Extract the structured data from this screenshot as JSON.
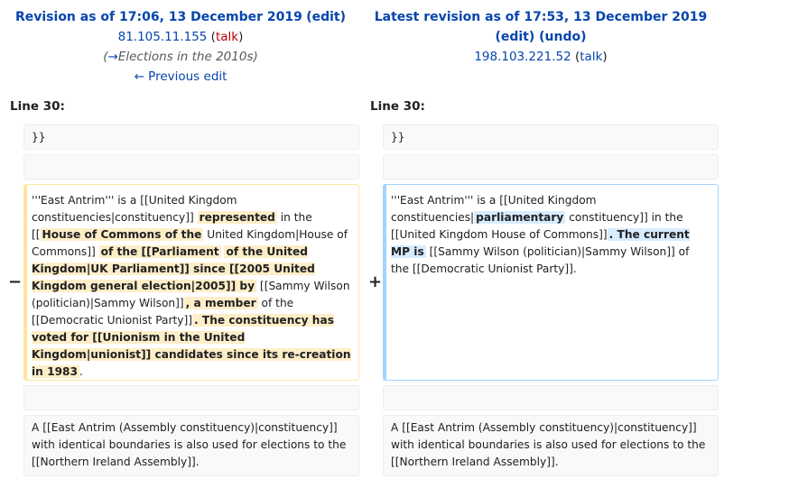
{
  "left_header": {
    "title": "Revision as of 17:06, 13 December 2019",
    "edit_label": "edit",
    "user_ip": "81.105.11.155",
    "talk_label": "talk",
    "comment_arrow": "→",
    "comment_text": "Elections in the 2010s",
    "prev_edit": "← Previous edit"
  },
  "right_header": {
    "title": "Latest revision as of 17:53, 13 December 2019",
    "edit_label": "edit",
    "undo_label": "undo",
    "user_ip": "198.103.221.52",
    "talk_label": "talk"
  },
  "line_label_left": "Line 30:",
  "line_label_right": "Line 30:",
  "rows": {
    "r1_left": "}}",
    "r1_right": "}}",
    "del_marker": "−",
    "ins_marker": "+",
    "del": {
      "p1": "'''East Antrim''' is a [[United Kingdom constituencies|constituency]] ",
      "x1": "represented",
      "p2": " in the [[",
      "x2": "House of Commons of the",
      "p3": " United Kingdom|House of Commons]] ",
      "x3": "of the [[Parliament",
      "p4": " ",
      "x4": "of the United Kingdom|UK Parliament]] since [[2005 United Kingdom general election|2005]] by",
      "p5": " [[Sammy Wilson (politician)|Sammy Wilson]]",
      "x5": ", a member",
      "p6": " of the [[Democratic Unionist Party]]",
      "x6": ". The constituency has voted for [[Unionism in the United Kingdom|unionist]] candidates since its re-creation in 1983",
      "p7": "."
    },
    "ins": {
      "p1": "'''East Antrim''' is a [[United Kingdom constituencies|",
      "x1": "parliamentary",
      "p2": " constituency]] in the [[United Kingdom House of Commons]]",
      "x2": ". The current MP is",
      "p3": " [[Sammy Wilson (politician)|Sammy Wilson]] of the [[Democratic Unionist Party]]."
    },
    "r3_left": "A [[East Antrim (Assembly constituency)|constituency]] with identical boundaries is also used for elections to the [[Northern Ireland Assembly]].",
    "r3_right": "A [[East Antrim (Assembly constituency)|constituency]] with identical boundaries is also used for elections to the [[Northern Ireland Assembly]]."
  }
}
